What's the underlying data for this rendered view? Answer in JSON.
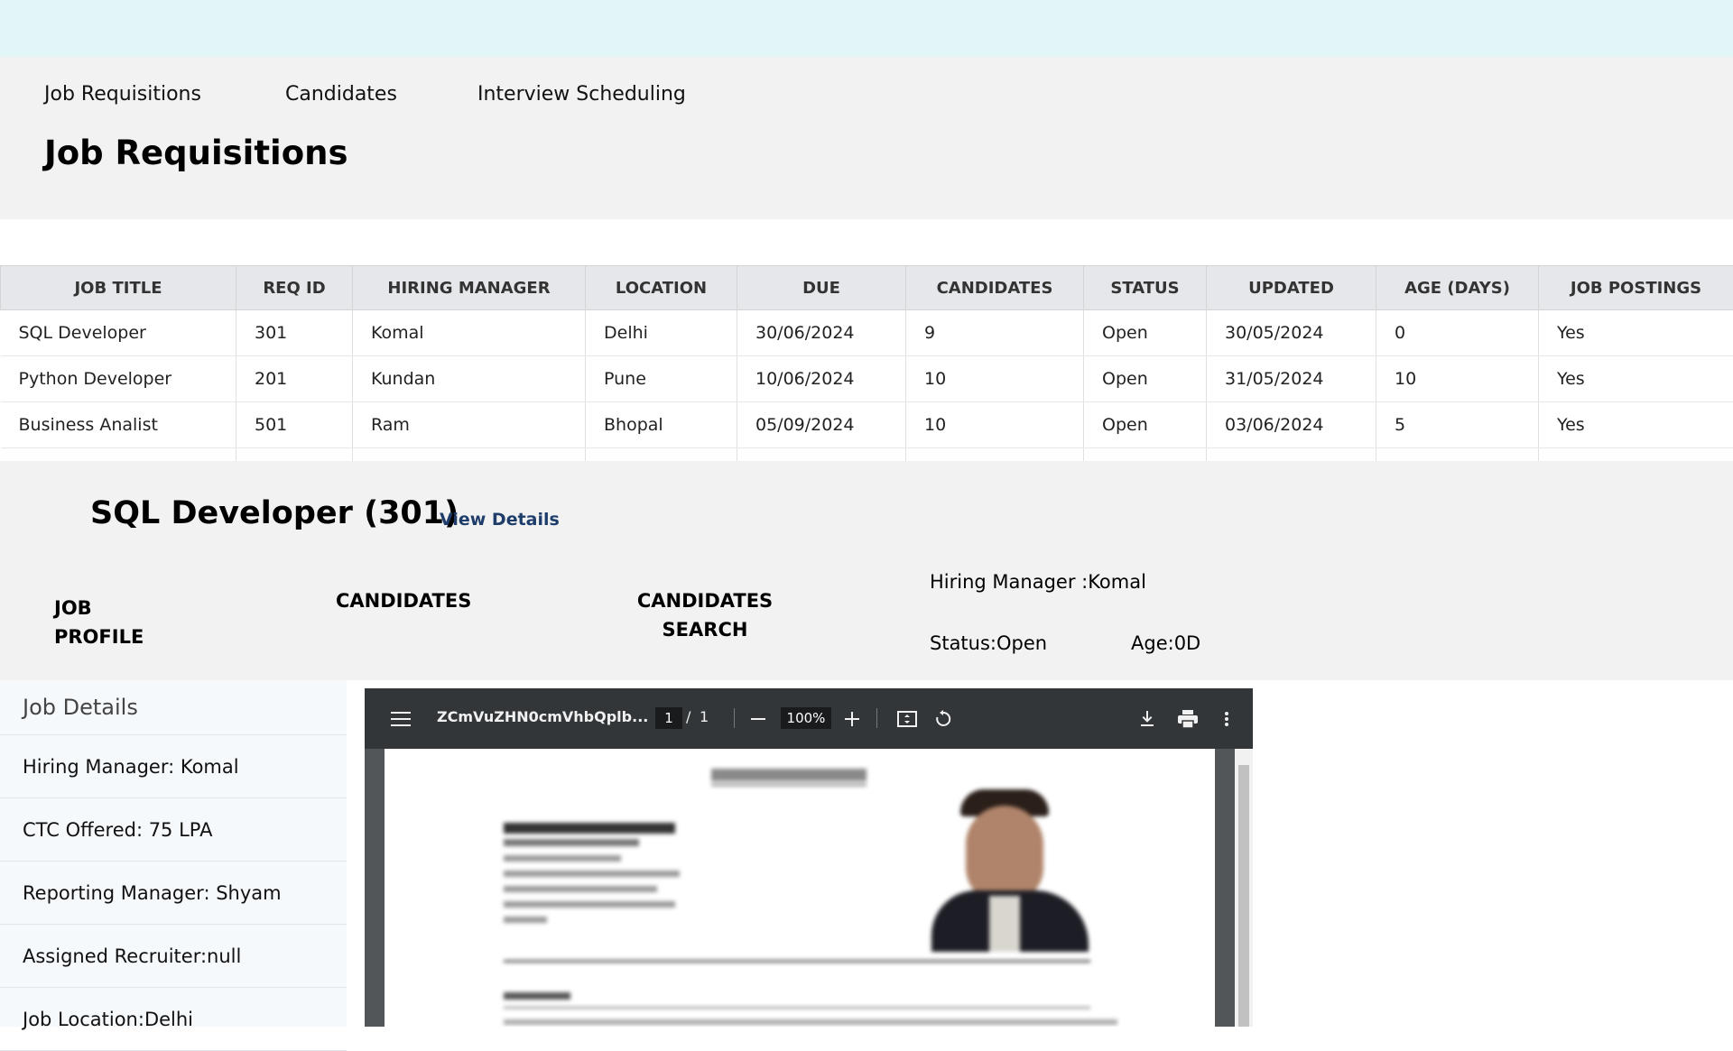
{
  "nav": {
    "items": [
      "Job Requisitions",
      "Candidates",
      "Interview Scheduling"
    ]
  },
  "page_title": "Job Requisitions",
  "table": {
    "columns": [
      "JOB TITLE",
      "REQ ID",
      "HIRING MANAGER",
      "LOCATION",
      "DUE",
      "CANDIDATES",
      "STATUS",
      "UPDATED",
      "AGE (DAYS)",
      "JOB POSTINGS"
    ],
    "rows": [
      [
        "SQL Developer",
        "301",
        "Komal",
        "Delhi",
        "30/06/2024",
        "9",
        "Open",
        "30/05/2024",
        "0",
        "Yes"
      ],
      [
        "Python Developer",
        "201",
        "Kundan",
        "Pune",
        "10/06/2024",
        "10",
        "Open",
        "31/05/2024",
        "10",
        "Yes"
      ],
      [
        "Business Analist",
        "501",
        "Ram",
        "Bhopal",
        "05/09/2024",
        "10",
        "Open",
        "03/06/2024",
        "5",
        "Yes"
      ]
    ]
  },
  "detail": {
    "title": "SQL Developer (301)",
    "view_details": "View Details",
    "tabs": [
      "JOB PROFILE",
      "CANDIDATES",
      "CANDIDATES SEARCH"
    ],
    "hiring_manager": "Hiring Manager :Komal",
    "status": "Status:Open",
    "age": "Age:0D"
  },
  "sidebar": {
    "heading": "Job Details",
    "items": [
      "Hiring Manager: Komal",
      "CTC Offered: 75 LPA",
      "Reporting Manager: Shyam",
      "Assigned Recruiter:null",
      "Job Location:Delhi"
    ]
  },
  "pdf_viewer": {
    "filename": "ZCmVuZHN0cmVhbQplb...",
    "page": "1",
    "page_sep": "/",
    "total_pages": "1",
    "zoom": "100%",
    "icons": [
      "menu-icon",
      "zoom-out-icon",
      "zoom-in-icon",
      "fit-page-icon",
      "rotate-icon",
      "download-icon",
      "print-icon",
      "more-options-icon"
    ],
    "colors": {
      "toolbar": "#323639",
      "background": "#525659"
    }
  },
  "colors": {
    "topbar": "#e2f6f8",
    "header": "#f2f2f2",
    "table_header": "#e6e7ea",
    "link": "#1f3d6a"
  }
}
